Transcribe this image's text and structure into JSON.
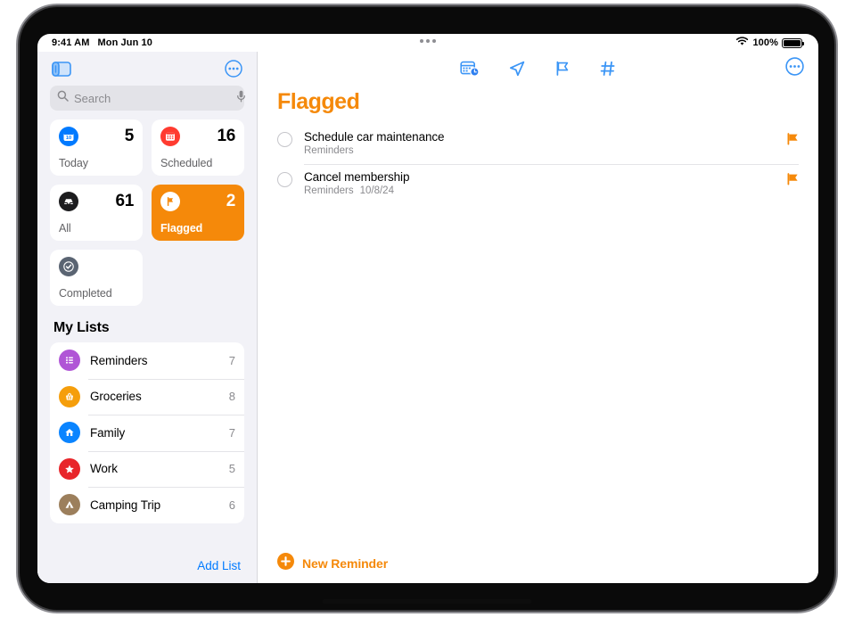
{
  "statusbar": {
    "time": "9:41 AM",
    "date": "Mon Jun 10",
    "battery_percent": "100%",
    "wifi_icon": "wifi-icon",
    "battery_icon": "battery-icon"
  },
  "sidebar": {
    "toggle_icon": "sidebar-toggle-icon",
    "more_icon": "more-options-icon",
    "search": {
      "placeholder": "Search",
      "value": "",
      "search_icon": "search-icon",
      "mic_icon": "microphone-icon"
    },
    "smart_lists": [
      {
        "label": "Today",
        "count": "5",
        "icon": "calendar-day-icon",
        "color": "#007AFF",
        "selected": false
      },
      {
        "label": "Scheduled",
        "count": "16",
        "icon": "calendar-icon",
        "color": "#FF3B30",
        "selected": false
      },
      {
        "label": "All",
        "count": "61",
        "icon": "inbox-icon",
        "color": "#1C1C1E",
        "selected": false
      },
      {
        "label": "Flagged",
        "count": "2",
        "icon": "flag-icon",
        "color": "#F5890A",
        "selected": true
      },
      {
        "label": "Completed",
        "count": "",
        "icon": "checkmark-circle-icon",
        "color": "#5A6472",
        "selected": false
      }
    ],
    "my_lists_title": "My Lists",
    "my_lists": [
      {
        "name": "Reminders",
        "count": "7",
        "icon": "bulleted-list-icon",
        "color": "#B055D6"
      },
      {
        "name": "Groceries",
        "count": "8",
        "icon": "shopping-basket-icon",
        "color": "#F59E0B"
      },
      {
        "name": "Family",
        "count": "7",
        "icon": "house-icon",
        "color": "#0A84FF"
      },
      {
        "name": "Work",
        "count": "5",
        "icon": "star-icon",
        "color": "#E8252A"
      },
      {
        "name": "Camping Trip",
        "count": "6",
        "icon": "tent-icon",
        "color": "#9C7F5C"
      }
    ],
    "add_list_label": "Add List"
  },
  "detail": {
    "toolbar_icons": [
      {
        "name": "calendar-add-icon"
      },
      {
        "name": "location-arrow-icon"
      },
      {
        "name": "flag-icon"
      },
      {
        "name": "hashtag-icon"
      }
    ],
    "more_icon": "more-options-icon",
    "title": "Flagged",
    "title_color": "#F5890A",
    "reminders": [
      {
        "title": "Schedule car maintenance",
        "list": "Reminders",
        "date": "",
        "flagged": true
      },
      {
        "title": "Cancel membership",
        "list": "Reminders",
        "date": "10/8/24",
        "flagged": true
      }
    ],
    "new_reminder_label": "New Reminder",
    "add_icon": "plus-circle-icon"
  }
}
